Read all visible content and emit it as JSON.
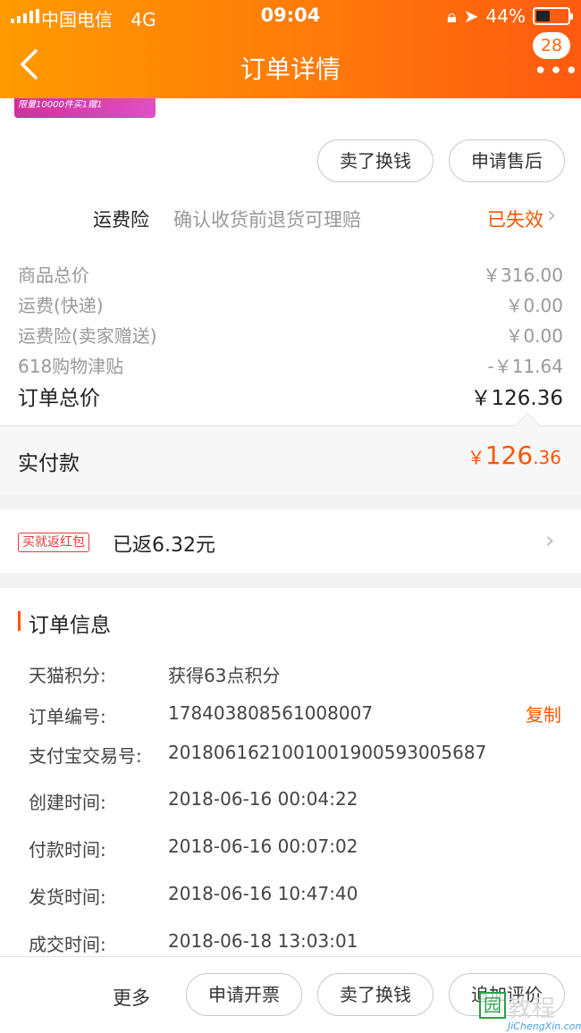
{
  "status_bar": {
    "carrier": "中国电信",
    "network": "4G",
    "time": "09:04",
    "battery_percent": "44%",
    "battery_level": 0.44
  },
  "header": {
    "title": "订单详情",
    "back_icon": "chevron-left-icon",
    "notification_count": "28",
    "more_icon": "more-dots-icon"
  },
  "promo_banner": {
    "text": "限量10000件买1赠1"
  },
  "actions_top": {
    "sell_label": "卖了换钱",
    "after_sale_label": "申请售后"
  },
  "shipping_insurance": {
    "label": "运费险",
    "description": "确认收货前退货可理赔",
    "status": "已失效"
  },
  "price_breakdown": [
    {
      "label": "商品总价",
      "value": "￥316.00"
    },
    {
      "label": "运费(快递)",
      "value": "￥0.00"
    },
    {
      "label": "运费险(卖家赠送)",
      "value": "￥0.00"
    },
    {
      "label": "618购物津贴",
      "value": "-￥11.64"
    }
  ],
  "order_total": {
    "label": "订单总价",
    "value": "￥126.36"
  },
  "paid": {
    "label": "实付款",
    "currency": "￥",
    "integer": "126",
    "decimal": ".36"
  },
  "red_packet": {
    "tag": "买就返红包",
    "text": "已返6.32元"
  },
  "order_info": {
    "title": "订单信息",
    "rows": [
      {
        "label": "天猫积分:",
        "value": "获得63点积分"
      },
      {
        "label": "订单编号:",
        "value": "178403808561008007"
      },
      {
        "label": "支付宝交易号:",
        "value": "2018061621001001900593005687"
      },
      {
        "label": "创建时间:",
        "value": "2018-06-16 00:04:22"
      },
      {
        "label": "付款时间:",
        "value": "2018-06-16 00:07:02"
      },
      {
        "label": "发货时间:",
        "value": "2018-06-16 10:47:40"
      },
      {
        "label": "成交时间:",
        "value": "2018-06-18 13:03:01"
      }
    ],
    "copy_label": "复制"
  },
  "bottom_bar": {
    "more_label": "更多",
    "invoice_label": "申请开票",
    "sell_label": "卖了换钱",
    "review_label": "追加评价"
  },
  "colors": {
    "header_gradient_start": "#ff9a00",
    "header_gradient_end": "#ff5a10",
    "accent": "#ff5500",
    "red_tag": "#e4393c"
  }
}
